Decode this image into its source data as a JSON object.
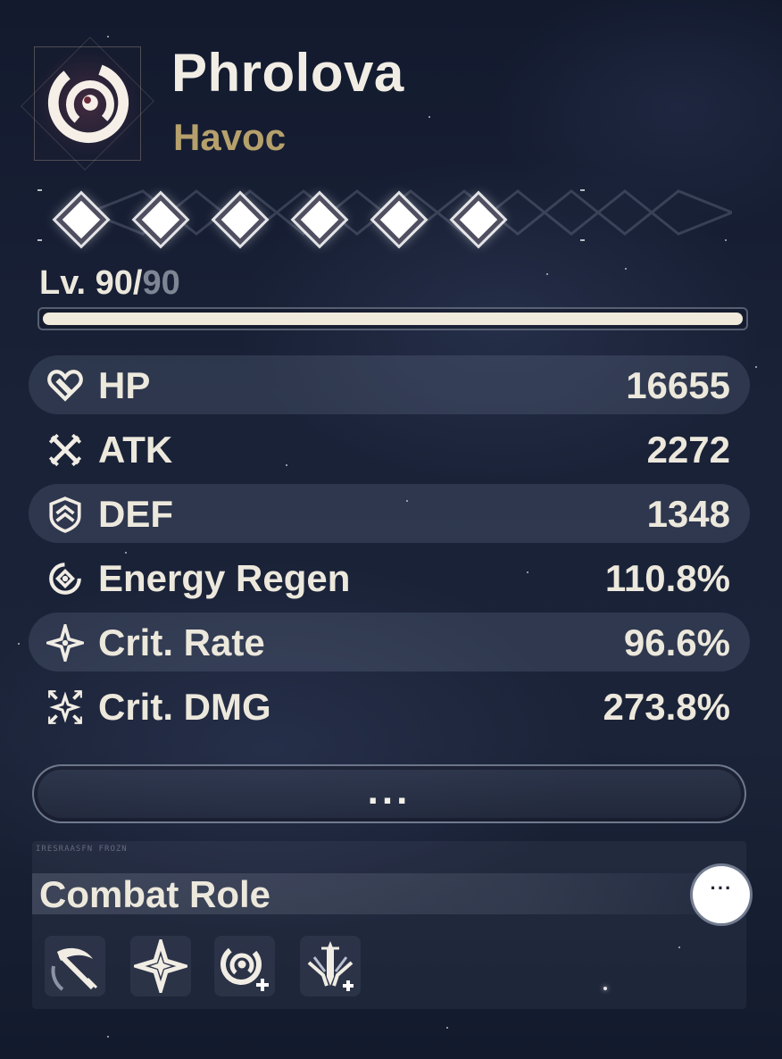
{
  "character": {
    "name": "Phrolova",
    "element": "Havoc",
    "element_icon": "havoc-swirl-icon"
  },
  "sequence": {
    "unlocked": 6,
    "total": 6
  },
  "level": {
    "current": "Lv. 90/",
    "max": "90",
    "progress": 1.0
  },
  "stats": [
    {
      "name": "HP",
      "value": "16655",
      "icon": "hp-icon"
    },
    {
      "name": "ATK",
      "value": "2272",
      "icon": "atk-icon"
    },
    {
      "name": "DEF",
      "value": "1348",
      "icon": "def-icon"
    },
    {
      "name": "Energy Regen",
      "value": "110.8%",
      "icon": "energy-regen-icon"
    },
    {
      "name": "Crit. Rate",
      "value": "96.6%",
      "icon": "crit-rate-icon"
    },
    {
      "name": "Crit. DMG",
      "value": "273.8%",
      "icon": "crit-dmg-icon"
    }
  ],
  "more_button": {
    "label": "..."
  },
  "combat_role": {
    "tag": "IRESRAASFN FROZN",
    "title": "Combat Role",
    "info_label": "···",
    "roles": [
      "slash-role-icon",
      "star-role-icon",
      "havoc-plus-role-icon",
      "sword-plus-role-icon"
    ]
  },
  "colors": {
    "accent_gold": "#b6a06c",
    "text_light": "#ece8dc",
    "level_max_grey": "#7e8594"
  }
}
